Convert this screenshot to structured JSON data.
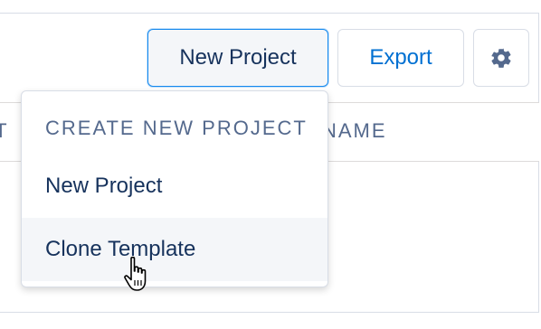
{
  "toolbar": {
    "new_project_label": "New Project",
    "export_label": "Export",
    "settings_icon": "gear-icon"
  },
  "table": {
    "column_headers": [
      "IT",
      "NAME"
    ]
  },
  "dropdown": {
    "heading": "CREATE NEW PROJECT",
    "items": [
      {
        "label": "New Project"
      },
      {
        "label": "Clone Template",
        "hovered": true
      }
    ]
  },
  "colors": {
    "brand_blue": "#0070d2",
    "text_dark": "#16325c",
    "text_muted": "#54698d",
    "border": "#d8dde6",
    "hover_bg": "#f4f6f9"
  },
  "cursor": "hand-pointer-icon"
}
